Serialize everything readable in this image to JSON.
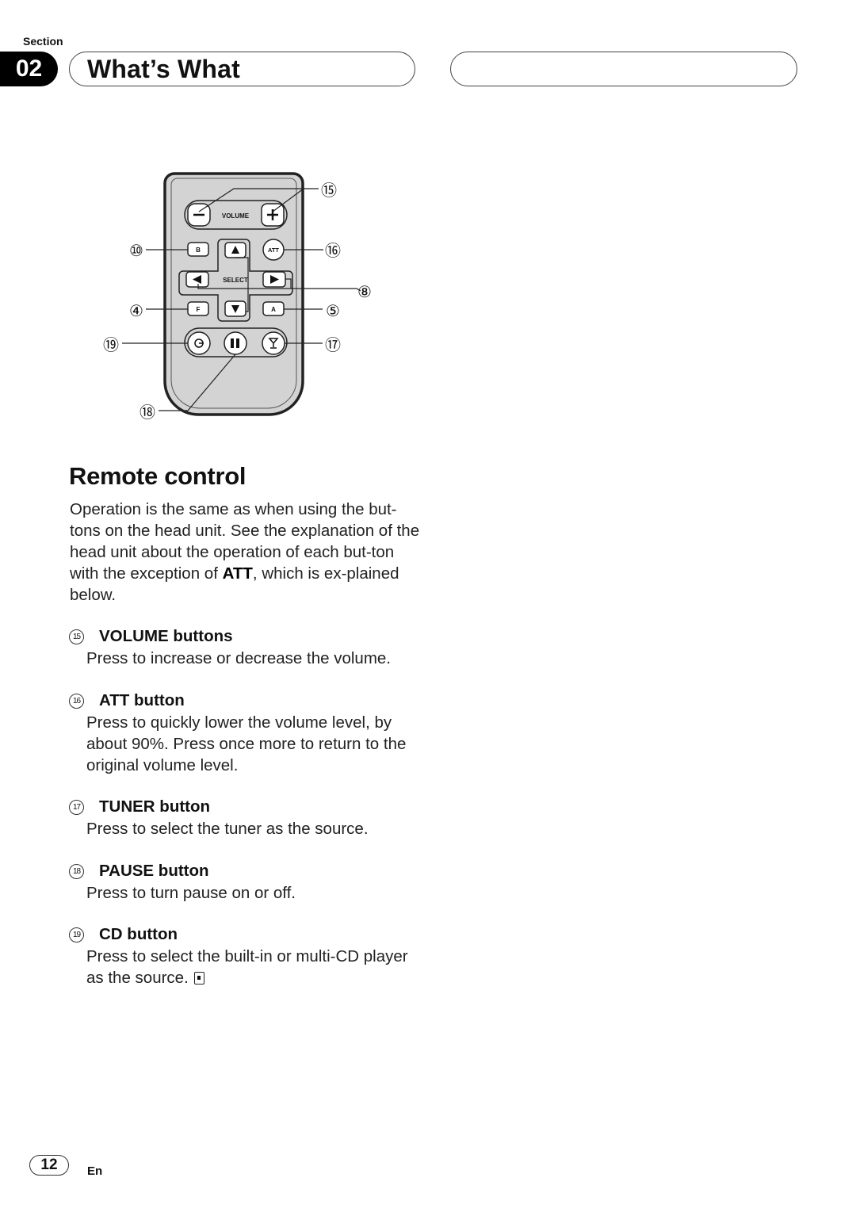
{
  "header": {
    "section_label": "Section",
    "section_number": "02",
    "title": "What’s What"
  },
  "remote": {
    "button_labels": {
      "volume": "VOLUME",
      "select": "SELECT",
      "b": "B",
      "f": "F",
      "a": "A",
      "att": "ATT"
    },
    "callouts": {
      "volume": "⑮",
      "att": "⑯",
      "select": "⑧",
      "b": "⑩",
      "f": "④",
      "a": "⑤",
      "cd": "⑲",
      "tuner": "⑰",
      "pause": "⑱"
    },
    "colors": {
      "body": "#d3d3d3",
      "outline": "#222222",
      "button": "#ffffff"
    }
  },
  "section": {
    "heading": "Remote control",
    "intro_part1": "Operation is the same as when using the but-tons on the head unit. See the explanation of the head unit about the operation of each but-ton with the exception of ",
    "intro_bold": "ATT",
    "intro_part2": ", which is ex-plained below."
  },
  "items": [
    {
      "number": "15",
      "title": "VOLUME buttons",
      "description": "Press to increase or decrease the volume."
    },
    {
      "number": "16",
      "title": "ATT button",
      "description": "Press to quickly lower the volume level, by about 90%. Press once more to return to the original volume level."
    },
    {
      "number": "17",
      "title": "TUNER button",
      "description": "Press to select the tuner as the source."
    },
    {
      "number": "18",
      "title": "PAUSE button",
      "description": "Press to turn pause on or off."
    },
    {
      "number": "19",
      "title": "CD button",
      "description": "Press to select the built-in or multi-CD player as the source."
    }
  ],
  "footer": {
    "page_number": "12",
    "language": "En"
  }
}
